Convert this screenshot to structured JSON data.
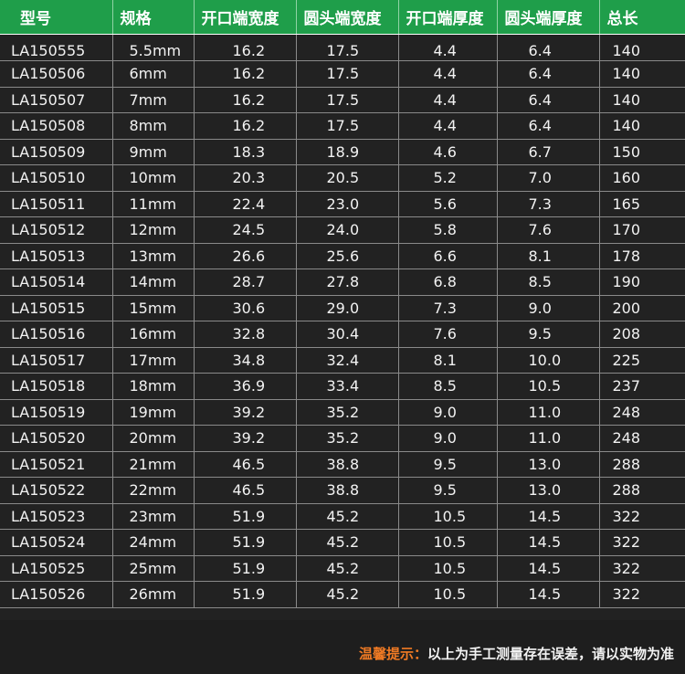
{
  "table": {
    "headers": [
      "型号",
      "规格",
      "开口端宽度",
      "圆头端宽度",
      "开口端厚度",
      "圆头端厚度",
      "总长"
    ],
    "rows": [
      [
        "LA150555",
        "5.5mm",
        "16.2",
        "17.5",
        "4.4",
        "6.4",
        "140"
      ],
      [
        "LA150506",
        "6mm",
        "16.2",
        "17.5",
        "4.4",
        "6.4",
        "140"
      ],
      [
        "LA150507",
        "7mm",
        "16.2",
        "17.5",
        "4.4",
        "6.4",
        "140"
      ],
      [
        "LA150508",
        "8mm",
        "16.2",
        "17.5",
        "4.4",
        "6.4",
        "140"
      ],
      [
        "LA150509",
        "9mm",
        "18.3",
        "18.9",
        "4.6",
        "6.7",
        "150"
      ],
      [
        "LA150510",
        "10mm",
        "20.3",
        "20.5",
        "5.2",
        "7.0",
        "160"
      ],
      [
        "LA150511",
        "11mm",
        "22.4",
        "23.0",
        "5.6",
        "7.3",
        "165"
      ],
      [
        "LA150512",
        "12mm",
        "24.5",
        "24.0",
        "5.8",
        "7.6",
        "170"
      ],
      [
        "LA150513",
        "13mm",
        "26.6",
        "25.6",
        "6.6",
        "8.1",
        "178"
      ],
      [
        "LA150514",
        "14mm",
        "28.7",
        "27.8",
        "6.8",
        "8.5",
        "190"
      ],
      [
        "LA150515",
        "15mm",
        "30.6",
        "29.0",
        "7.3",
        "9.0",
        "200"
      ],
      [
        "LA150516",
        "16mm",
        "32.8",
        "30.4",
        "7.6",
        "9.5",
        "208"
      ],
      [
        "LA150517",
        "17mm",
        "34.8",
        "32.4",
        "8.1",
        "10.0",
        "225"
      ],
      [
        "LA150518",
        "18mm",
        "36.9",
        "33.4",
        "8.5",
        "10.5",
        "237"
      ],
      [
        "LA150519",
        "19mm",
        "39.2",
        "35.2",
        "9.0",
        "11.0",
        "248"
      ],
      [
        "LA150520",
        "20mm",
        "39.2",
        "35.2",
        "9.0",
        "11.0",
        "248"
      ],
      [
        "LA150521",
        "21mm",
        "46.5",
        "38.8",
        "9.5",
        "13.0",
        "288"
      ],
      [
        "LA150522",
        "22mm",
        "46.5",
        "38.8",
        "9.5",
        "13.0",
        "288"
      ],
      [
        "LA150523",
        "23mm",
        "51.9",
        "45.2",
        "10.5",
        "14.5",
        "322"
      ],
      [
        "LA150524",
        "24mm",
        "51.9",
        "45.2",
        "10.5",
        "14.5",
        "322"
      ],
      [
        "LA150525",
        "25mm",
        "51.9",
        "45.2",
        "10.5",
        "14.5",
        "322"
      ],
      [
        "LA150526",
        "26mm",
        "51.9",
        "45.2",
        "10.5",
        "14.5",
        "322"
      ]
    ]
  },
  "footer": {
    "label": "温馨提示：",
    "text": "以上为手工测量存在误差，请以实物为准"
  },
  "colors": {
    "header_bg": "#1f9e4a",
    "body_bg": "#222222",
    "note_label": "#f07a24"
  }
}
